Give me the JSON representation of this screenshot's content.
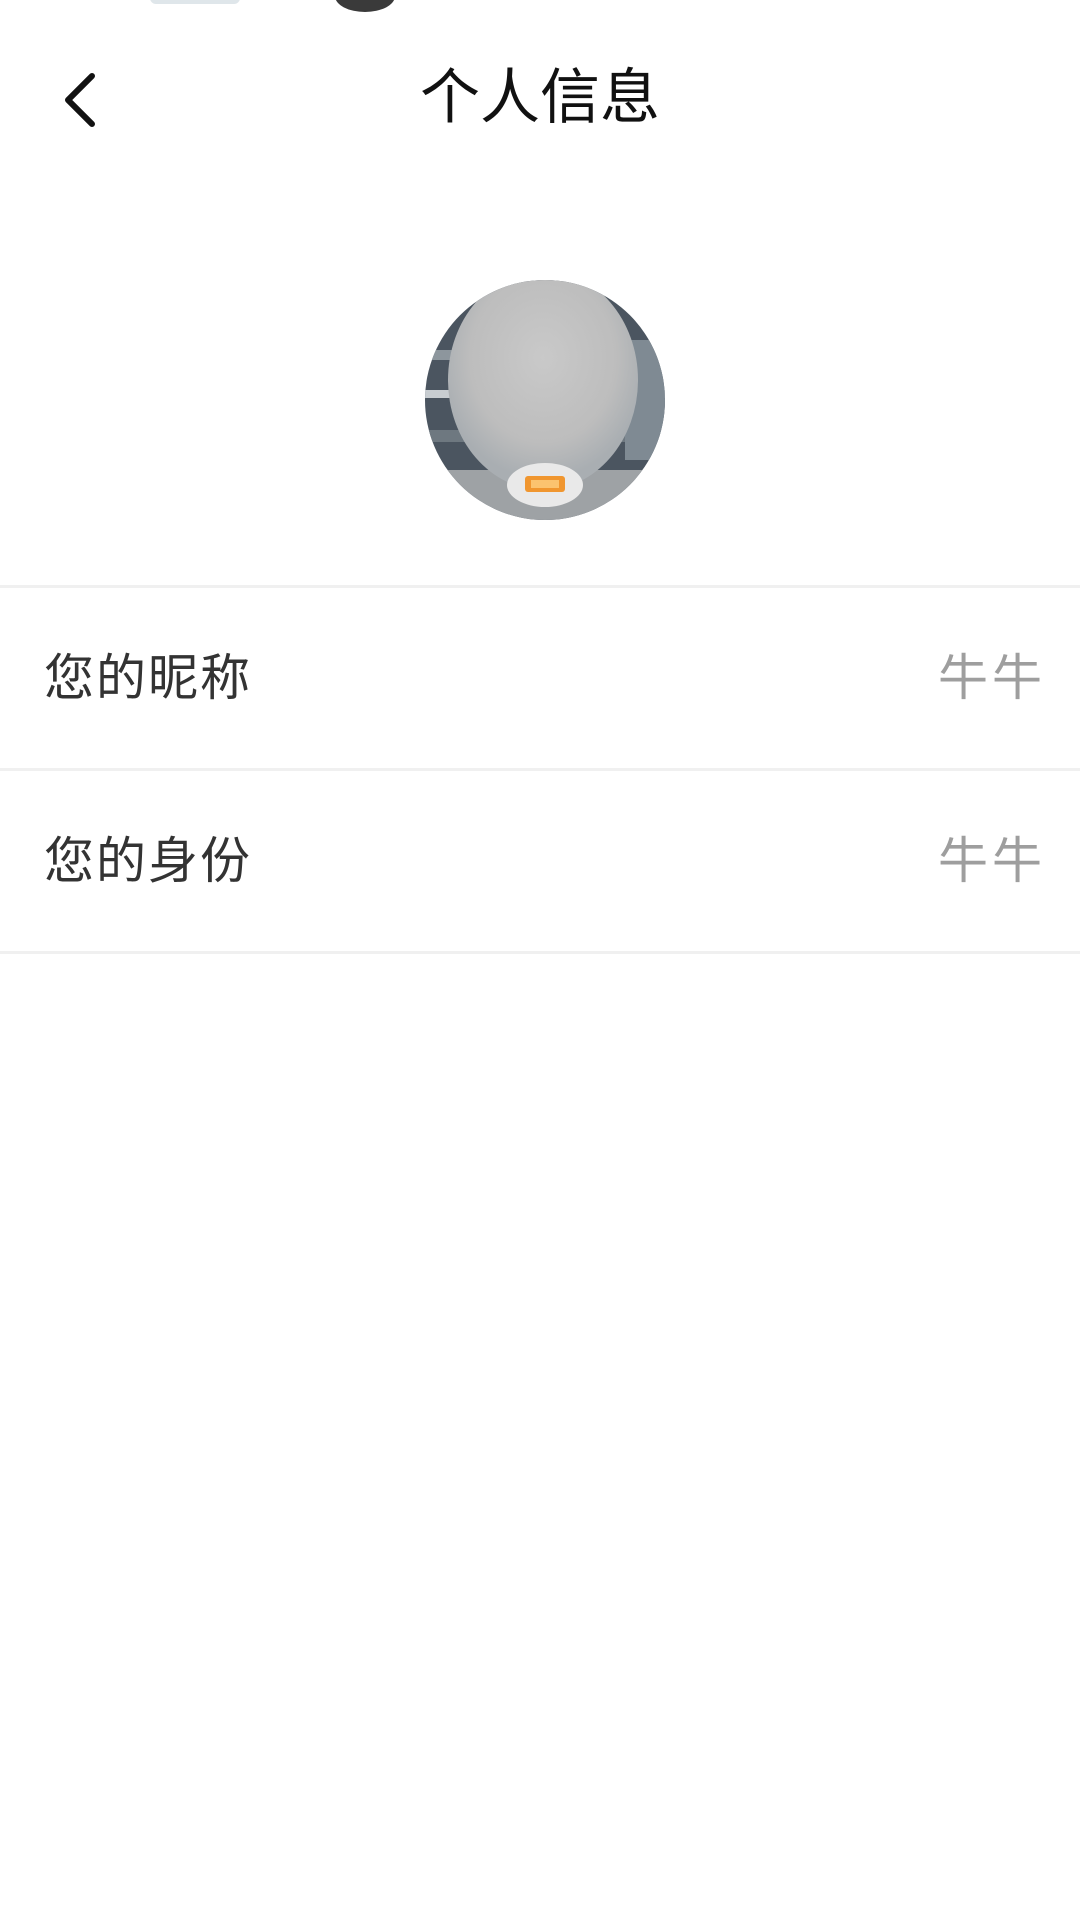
{
  "header": {
    "title": "个人信息",
    "back_icon": "chevron-left-icon"
  },
  "profile": {
    "avatar_icon": "user-avatar"
  },
  "rows": [
    {
      "label": "您的昵称",
      "value": "牛牛"
    },
    {
      "label": "您的身份",
      "value": "牛牛"
    }
  ],
  "colors": {
    "background": "#ffffff",
    "title_text": "#111111",
    "label_text": "#333333",
    "value_text": "#9e9e9e",
    "divider": "#f0f0f0"
  }
}
